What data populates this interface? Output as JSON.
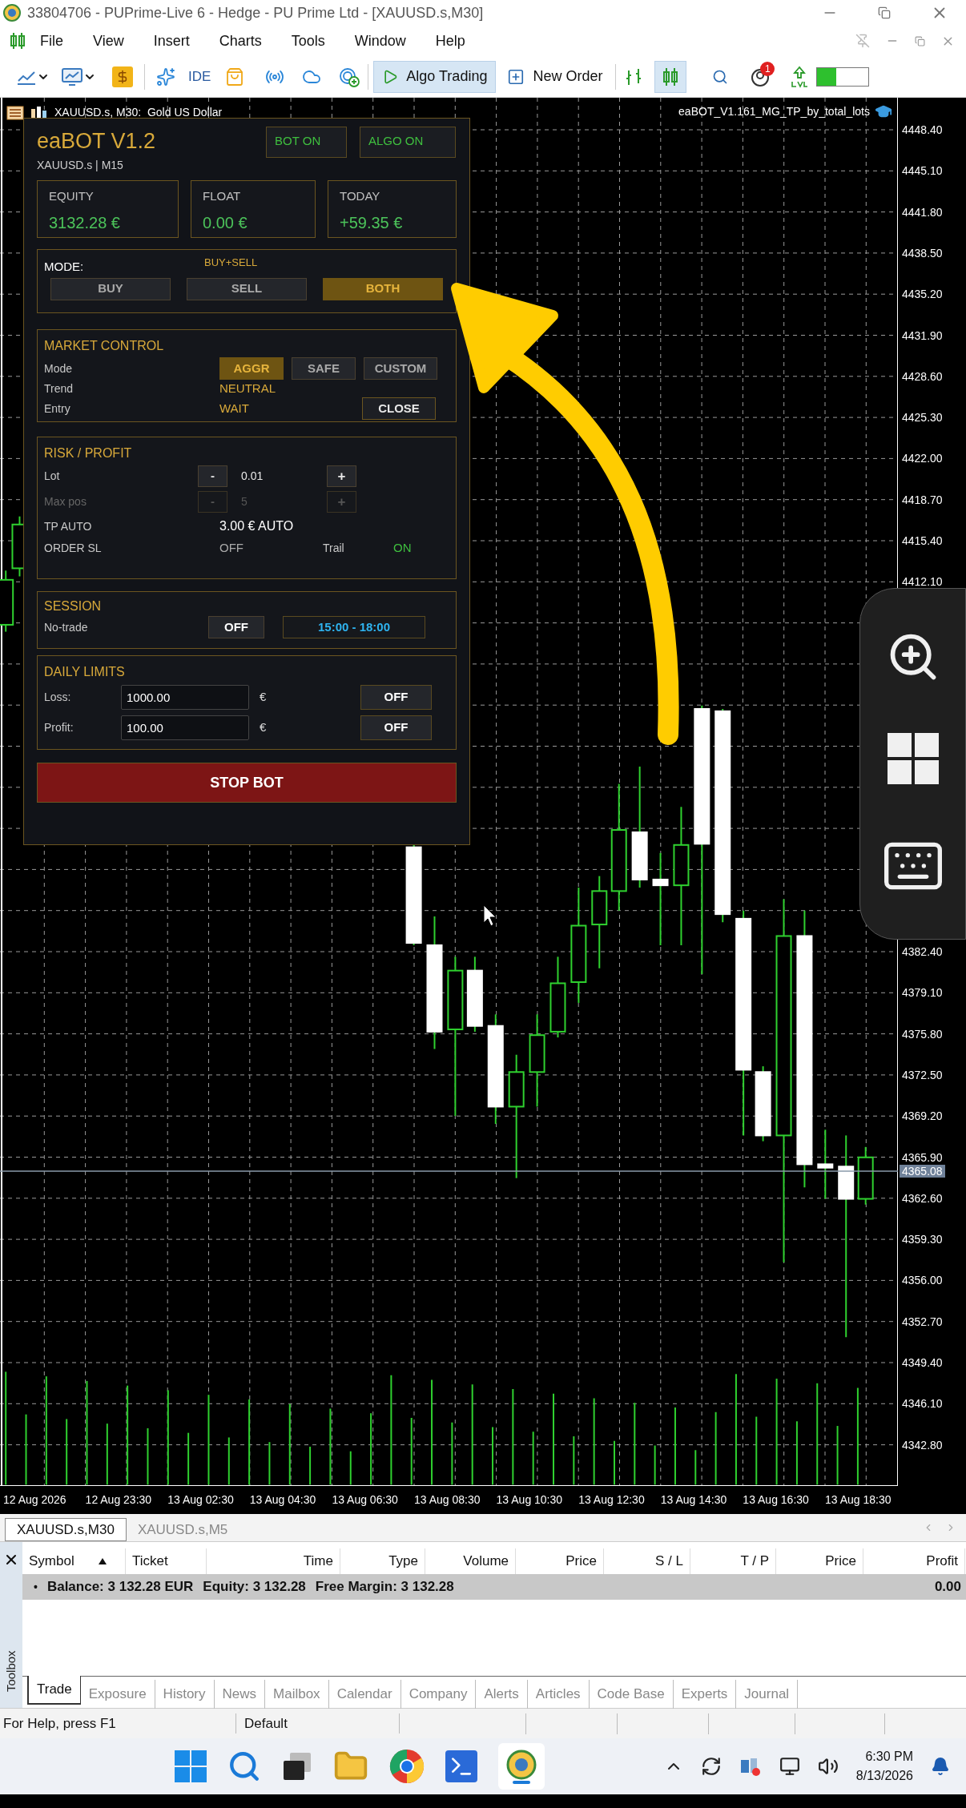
{
  "window": {
    "title": "33804706 - PUPrime-Live 6 - Hedge - PU Prime Ltd - [XAUUSD.s,M30]"
  },
  "menu": [
    "File",
    "View",
    "Insert",
    "Charts",
    "Tools",
    "Window",
    "Help"
  ],
  "toolbar": {
    "ide": "IDE",
    "algo_trading": {
      "label": "Algo Trading",
      "active": true
    },
    "new_order": "New Order",
    "candles_active": true,
    "notifications": "1"
  },
  "chart": {
    "symbol_label": "XAUUSD.s, M30:  Gold US Dollar",
    "expert": "eaBOT_V1.161_MG_TP_by_total_lots",
    "price_axis_upper": [
      "4448.40",
      "4445.10",
      "4441.80",
      "4438.50",
      "4435.20",
      "4431.90",
      "4428.60",
      "4425.30",
      "4422.00",
      "4418.70",
      "4415.40",
      "4412.10"
    ],
    "price_axis_lower": [
      "4382.40",
      "4379.10",
      "4375.80",
      "4372.50",
      "4369.20",
      "4365.90",
      "4362.60",
      "4359.30",
      "4356.00",
      "4352.70",
      "4349.40",
      "4346.10",
      "4342.80"
    ],
    "current_price": "4365.08",
    "time_axis": [
      "12 Aug 2026",
      "12 Aug 23:30",
      "13 Aug 02:30",
      "13 Aug 04:30",
      "13 Aug 06:30",
      "13 Aug 08:30",
      "13 Aug 10:30",
      "13 Aug 12:30",
      "13 Aug 14:30",
      "13 Aug 16:30",
      "13 Aug 18:30"
    ]
  },
  "panel": {
    "title": "eaBOT V1.2",
    "subtitle": "XAUUSD.s | M15",
    "badges": [
      {
        "label": "BOT ON",
        "on": true
      },
      {
        "label": "ALGO ON",
        "on": true
      }
    ],
    "stats": [
      {
        "label": "EQUITY",
        "value": "3132.28 €"
      },
      {
        "label": "FLOAT",
        "value": "0.00 €"
      },
      {
        "label": "TODAY",
        "value": "+59.35 €"
      }
    ],
    "mode": {
      "label": "MODE:",
      "value": "BUY+SELL",
      "options": [
        {
          "label": "BUY",
          "selected": false
        },
        {
          "label": "SELL",
          "selected": false
        },
        {
          "label": "BOTH",
          "selected": true
        }
      ]
    },
    "market_control": {
      "title": "MARKET CONTROL",
      "mode_label": "Mode",
      "modes": [
        {
          "label": "AGGR",
          "selected": true
        },
        {
          "label": "SAFE",
          "selected": false
        },
        {
          "label": "CUSTOM",
          "selected": false
        }
      ],
      "trend_label": "Trend",
      "trend": "NEUTRAL",
      "entry_label": "Entry",
      "entry": "WAIT",
      "close_button": "CLOSE"
    },
    "risk_profit": {
      "title": "RISK / PROFIT",
      "steppers": [
        {
          "label": "Lot",
          "minus": "-",
          "value": "0.01",
          "plus": "+",
          "disabled": false
        },
        {
          "label": "Max pos",
          "minus": "-",
          "value": "5",
          "plus": "+",
          "disabled": true
        }
      ],
      "tp_label": "TP AUTO",
      "tp_value": "3.00 € AUTO",
      "sl_label": "ORDER SL",
      "sl_value": "OFF",
      "sl_on": false,
      "trail_label": "Trail",
      "trail_value": "ON",
      "trail_on": true
    },
    "session": {
      "title": "SESSION",
      "label": "No-trade",
      "toggle": "OFF",
      "toggle_on": false,
      "range": "15:00 - 18:00"
    },
    "daily_limits": {
      "title": "DAILY LIMITS",
      "rows": [
        {
          "label": "Loss:",
          "value": "1000.00",
          "currency": "€",
          "toggle": "OFF",
          "on": false
        },
        {
          "label": "Profit:",
          "value": "100.00",
          "currency": "€",
          "toggle": "OFF",
          "on": false
        }
      ]
    },
    "stop_button": "STOP BOT"
  },
  "chart_tabs": [
    {
      "label": "XAUUSD.s,M30",
      "selected": true
    },
    {
      "label": "XAUUSD.s,M5",
      "selected": false
    }
  ],
  "toolbox": {
    "label": "Toolbox",
    "columns": [
      {
        "label": "Symbol",
        "sorted": true
      },
      {
        "label": "Ticket",
        "sorted": false
      },
      {
        "label": "Time",
        "sorted": false
      },
      {
        "label": "Type",
        "sorted": false
      },
      {
        "label": "Volume",
        "sorted": false
      },
      {
        "label": "Price",
        "sorted": false
      },
      {
        "label": "S / L",
        "sorted": false
      },
      {
        "label": "T / P",
        "sorted": false
      },
      {
        "label": "Price",
        "sorted": false
      },
      {
        "label": "Profit",
        "sorted": false
      }
    ],
    "balance_row": {
      "bullet": "•",
      "parts": [
        "Balance: 3 132.28 EUR",
        "Equity: 3 132.28",
        "Free Margin: 3 132.28"
      ],
      "profit": "0.00"
    },
    "tabs": [
      {
        "label": "Trade",
        "selected": true
      },
      {
        "label": "Exposure",
        "selected": false
      },
      {
        "label": "History",
        "selected": false
      },
      {
        "label": "News",
        "selected": false
      },
      {
        "label": "Mailbox",
        "selected": false
      },
      {
        "label": "Calendar",
        "selected": false
      },
      {
        "label": "Company",
        "selected": false
      },
      {
        "label": "Alerts",
        "selected": false
      },
      {
        "label": "Articles",
        "selected": false
      },
      {
        "label": "Code Base",
        "selected": false
      },
      {
        "label": "Experts",
        "selected": false
      },
      {
        "label": "Journal",
        "selected": false
      }
    ]
  },
  "status_bar": [
    "For Help, press F1",
    "Default"
  ],
  "taskbar": {
    "time": "6:30 PM",
    "date": "8/13/2026"
  }
}
